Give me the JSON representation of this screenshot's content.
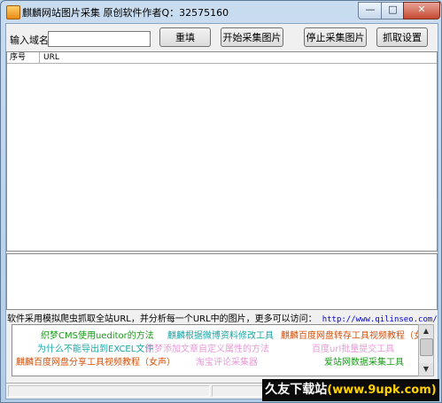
{
  "window": {
    "title": "麒麟网站图片采集 原创软件作者Q：32575160",
    "controls": {
      "minimize": "—",
      "maximize": "□",
      "close": "✕"
    }
  },
  "toolbar": {
    "url_label": "输入域名",
    "url_value": "",
    "reset_label": "重填",
    "start_label": "开始采集图片",
    "stop_label": "停止采集图片",
    "settings_label": "抓取设置"
  },
  "results_table": {
    "columns": [
      "序号",
      "URL"
    ],
    "rows": []
  },
  "notice": {
    "text": "软件采用模拟爬虫抓取全站URL，并分析每一个URL中的图片，更多可以访问：",
    "url": "http://www.qilinseo.com/"
  },
  "links": [
    {
      "label": "织梦CMS使用ueditor的方法",
      "color": "#1a9a1a"
    },
    {
      "label": "麒麟根据微博资料修改工具",
      "color": "#1aa6a6"
    },
    {
      "label": "麒麟百度网盘转存工具视频教程（女声）",
      "color": "#d4500a"
    },
    {
      "label": "为什么不能导出到EXCEL文件",
      "color": "#1aa6a6"
    },
    {
      "label": "织梦添加文章自定义属性的方法",
      "color": "#e59ad6"
    },
    {
      "label": "百度url批量提交工具",
      "color": "#e59ad6"
    },
    {
      "label": "麒麟百度网盘分享工具视频教程（女声）",
      "color": "#d4500a"
    },
    {
      "label": "淘宝评论采集器",
      "color": "#e59ad6"
    },
    {
      "label": "爱站网数据采集工具",
      "color": "#1a9a1a"
    }
  ],
  "watermark": {
    "brand": "久友下载站",
    "site": "(www.9upk.com)"
  },
  "colors": {
    "titlebar": "#c9dcf0",
    "client": "#f0f0f0",
    "link_green": "#1a9a1a",
    "link_cyan": "#1aa6a6",
    "link_orange": "#d4500a",
    "link_pink": "#e59ad6"
  }
}
